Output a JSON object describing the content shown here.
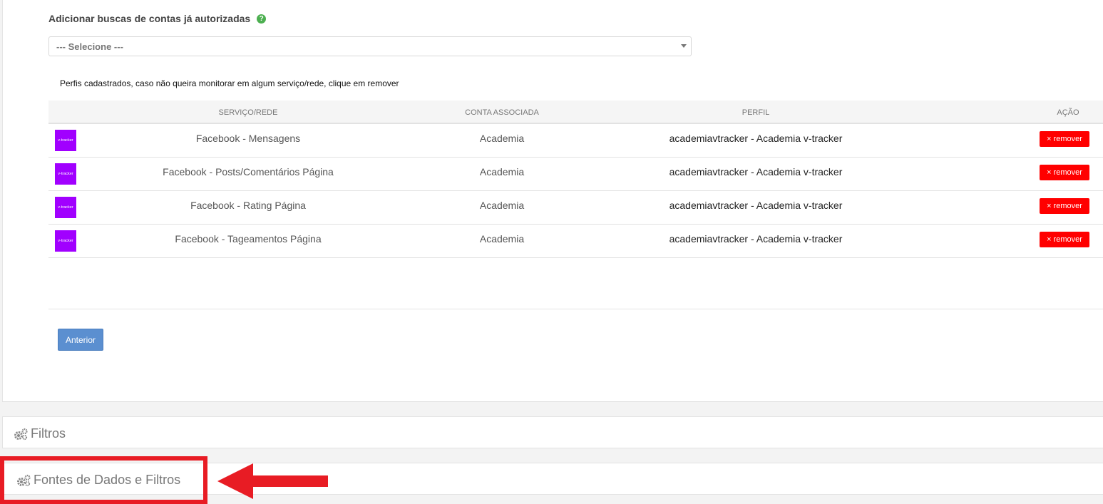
{
  "add_section": {
    "label": "Adicionar buscas de contas já autorizadas",
    "help_icon": "?",
    "select_value": "--- Selecione ---"
  },
  "profiles_note": "Perfis cadastrados, caso não queira monitorar em algum serviço/rede, clique em remover",
  "table": {
    "headers": {
      "servico": "SERVIÇO/REDE",
      "conta": "CONTA ASSOCIADA",
      "perfil": "PERFIL",
      "acao": "AÇÃO"
    },
    "logo_text": "v-tracker",
    "remove_label": "× remover",
    "rows": [
      {
        "servico": "Facebook - Mensagens",
        "conta": "Academia",
        "perfil": "academiavtracker - Academia v-tracker"
      },
      {
        "servico": "Facebook - Posts/Comentários Página",
        "conta": "Academia",
        "perfil": "academiavtracker - Academia v-tracker"
      },
      {
        "servico": "Facebook - Rating Página",
        "conta": "Academia",
        "perfil": "academiavtracker - Academia v-tracker"
      },
      {
        "servico": "Facebook - Tageamentos Página",
        "conta": "Academia",
        "perfil": "academiavtracker - Academia v-tracker"
      }
    ]
  },
  "prev_button": "Anterior",
  "sections": {
    "filtros": "Filtros",
    "fontes": "Fontes de Dados e Filtros"
  },
  "colors": {
    "remove": "#ff0000",
    "primary": "#5b8fd0",
    "logo": "#a100ff",
    "annotation": "#e81c24"
  }
}
